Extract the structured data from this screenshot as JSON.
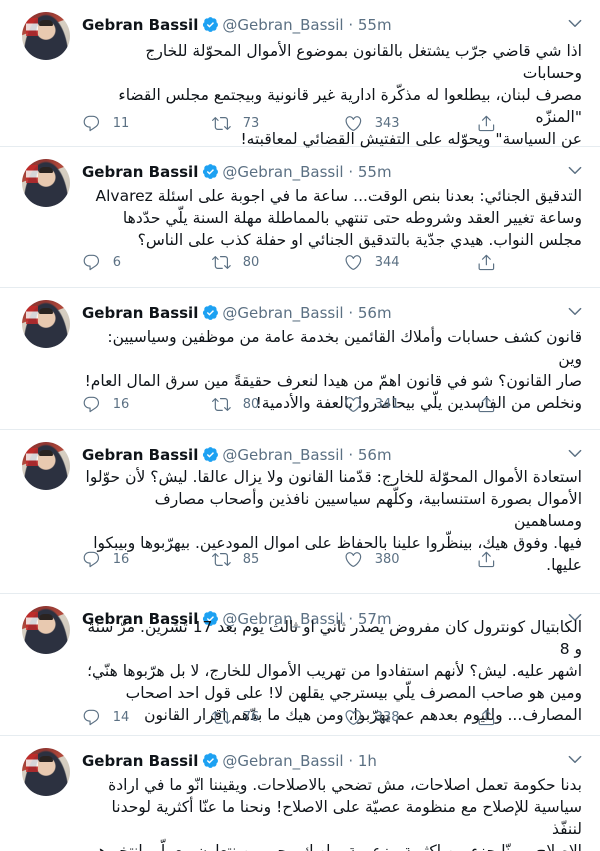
{
  "author": {
    "name": "Gebran Bassil",
    "handle": "@Gebran_Bassil",
    "dot": "·"
  },
  "icons": {
    "verified": "verified-badge-icon",
    "caret": "chevron-down-icon",
    "reply": "reply-icon",
    "retweet": "retweet-icon",
    "like": "heart-icon",
    "share": "share-icon"
  },
  "colors": {
    "verified": "#1da1f2",
    "muted": "#5b7083",
    "divider": "#e6ecf0"
  },
  "tweets": [
    {
      "time": "55m",
      "text": "اذا شي قاضي جرّب يشتغل بالقانون بموضوع الأموال المحوّلة للخارج وحسابات\nمصرف لبنان، بيطلعوا له  مذكّرة ادارية غير قانونية وبيجتمع مجلس القضاء \"المنزّه\nعن السياسة\" ويحوّله على التفتيش القضائي لمعاقبته!",
      "replies": "11",
      "retweets": "73",
      "likes": "343"
    },
    {
      "time": "55m",
      "text": "التدقيق الجنائي: بعدنا بنص الوقت... ساعة ما في اجوبة على اسئلة Alvarez\nوساعة تغيير العقد وشروطه حتى تنتهي بالمماطلة مهلة السنة يلّي حدّدها\nمجلس النواب. هيدي جدّية بالتدقيق الجنائي او حفلة كذب على الناس؟",
      "replies": "6",
      "retweets": "80",
      "likes": "344"
    },
    {
      "time": "56m",
      "text": "قانون كشف حسابات وأملاك القائمين بخدمة عامة من موظفين وسياسيين: وين\nصار القانون؟ شو في قانون اهمّ من هيدا لنعرف حقيقةً مين سرق المال العام!\nونخلص من الفاسدين يلّي بيحاضروا بالعفة والأدمية!",
      "replies": "16",
      "retweets": "80",
      "likes": "341"
    },
    {
      "time": "56m",
      "text": "استعادة الأموال المحوّلة للخارج: قدّمنا القانون ولا يزال عالقا. ليش؟ لأن حوّلوا\nالأموال بصورة استنسابية، وكلّهم سياسيين نافذين وأصحاب مصارف ومساهمين\nفيها. وفوق هيك، بينظّروا علينا بالحفاظ على اموال المودعين. بيهرّبوها  وبيبكوا\nعليها.",
      "replies": "16",
      "retweets": "85",
      "likes": "380"
    },
    {
      "time": "57m",
      "text": "الكابتيال كونترول كان مفروض يصدر ثاني او ثالث يوم بعد 17 تشرين. مرّ سنة و 8\nاشهر عليه. ليش؟ لأنهم استفادوا من تهريب الأموال للخارج، لا بل هرّبوها هنّي؛\nومين هو صاحب المصرف يلّي بيسترجي يقلهن لا! على قول احد اصحاب\nالمصارف... ولليوم بعدهم عم يهرّبوا، ومن هيك ما بدّهم اقرار القانون",
      "replies": "14",
      "retweets": "76",
      "likes": "338"
    },
    {
      "time": "1h",
      "text": "بدنا حكومة تعمل اصلاحات، مش تضحي بالاصلاحات. ويقيننا انّو ما في ارادة\nسياسية للإصلاح مع منظومة عصيّة على الاصلاح! ونحنا ما عنّا أكثرية لوحدنا لننفّذ\nالاصلاح، ومنّا جزء من اكثرية مزعومة. ولهيك مجبورين نتعاون مع يلّي انتخبوهم\nالناس بمجلس النواب لتأمين الأكثرية لكلّ قانون او مشروع",
      "replies": "",
      "retweets": "",
      "likes": ""
    }
  ]
}
